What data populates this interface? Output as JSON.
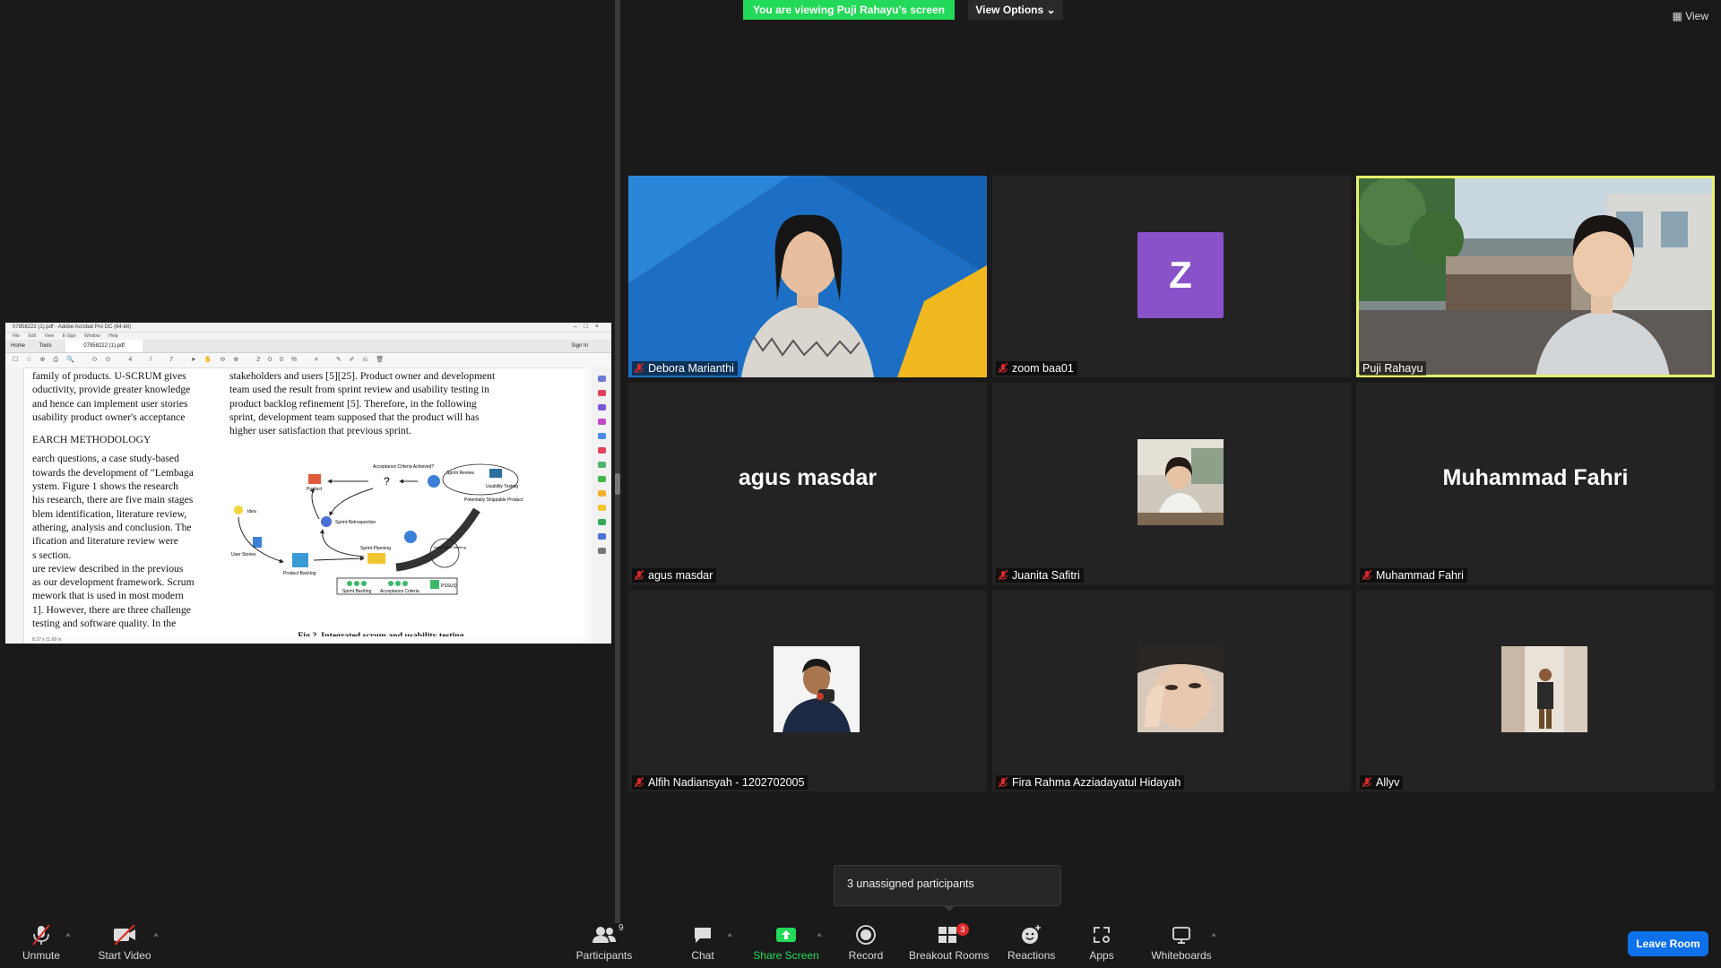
{
  "banner": {
    "viewing": "You are viewing Puji Rahayu's screen",
    "view_options": "View Options",
    "view": "View"
  },
  "acrobat": {
    "title": "07858222 (1).pdf - Adobe Acrobat Pro DC (64-bit)",
    "menu": [
      "File",
      "Edit",
      "View",
      "E-Sign",
      "Window",
      "Help"
    ],
    "tabs": {
      "home": "Home",
      "tools": "Tools",
      "doc": "07858222 (1).pdf",
      "signin": "Sign In"
    },
    "toolbar_zoom": "200%",
    "toolbar_page": "4 / 7",
    "left_text": [
      "family of products. U-SCRUM gives",
      "oductivity, provide greater knowledge",
      "and hence can implement user stories",
      "usability product owner's acceptance"
    ],
    "section_heading": "EARCH METHODOLOGY",
    "left_text_2": [
      "earch questions, a case study-based",
      "towards the development of \"Lembaga",
      "ystem.   Figure 1 shows the research",
      "his research, there are five main stages",
      "blem identification, literature review,",
      "athering, analysis and conclusion. The",
      "ification and literature review were",
      "s section.",
      "ure review described in the previous",
      "as our development framework. Scrum",
      "mework that is used in most modern",
      "1].  However, there are three challenge",
      "  testing and software quality. In the"
    ],
    "right_text": [
      "stakeholders and users [5][25]. Product owner and development",
      "team used the result from sprint review and usability testing in",
      "product backlog refinement [5]. Therefore, in the following",
      "sprint, development team supposed that the product will has",
      "higher user satisfaction that previous sprint."
    ],
    "figure_labels": {
      "product": "Product",
      "criteria": "Acceptance Criteria Achieved?",
      "sprint_review": "Sprint Review",
      "usability": "Usability Testing",
      "potentially": "Potentially Shippable Product",
      "idea": "Idea",
      "retrospective": "Sprint Retrospective",
      "user_stories": "User Stories",
      "backlog": "Product Backlog",
      "planning": "Sprint Planning",
      "daily": "Daily Sprint Meeting",
      "sprint_backlog": "Sprint Backlog",
      "acceptance": "Acceptance Criteria",
      "pssuq": "PSSUQ"
    },
    "caption": "Fig 2. Integrated scrum and usability testing",
    "status": "8.27 x 11.69 in"
  },
  "participants": [
    {
      "name": "Debora Marianthi",
      "kind": "video-debora"
    },
    {
      "name": "zoom baa01",
      "kind": "avatar",
      "initial": "Z"
    },
    {
      "name": "Puji Rahayu",
      "kind": "video-puji",
      "active": true
    },
    {
      "name": "agus masdar",
      "kind": "bigname",
      "display": "agus masdar"
    },
    {
      "name": "Juanita Safitri",
      "kind": "thumb"
    },
    {
      "name": "Muhammad Fahri",
      "kind": "bigname",
      "display": "Muhammad Fahri"
    },
    {
      "name": "Alfih Nadiansyah - 1202702005",
      "kind": "thumb"
    },
    {
      "name": "Fira Rahma Azziadayatul Hidayah",
      "kind": "thumb"
    },
    {
      "name": "Allyv",
      "kind": "thumb"
    }
  ],
  "tooltip": "3 unassigned participants",
  "toolbar": {
    "unmute": "Unmute",
    "start_video": "Start Video",
    "participants": "Participants",
    "participant_count": "9",
    "chat": "Chat",
    "share_screen": "Share Screen",
    "record": "Record",
    "breakout_rooms": "Breakout Rooms",
    "breakout_badge": "3",
    "reactions": "Reactions",
    "apps": "Apps",
    "whiteboards": "Whiteboards",
    "leave_room": "Leave Room"
  },
  "colors": {
    "share_green": "#23d959",
    "leave_blue": "#0e71eb",
    "active_border": "#e8f26b",
    "avatar_purple": "#8a52c9",
    "mute_red": "#e02828"
  }
}
